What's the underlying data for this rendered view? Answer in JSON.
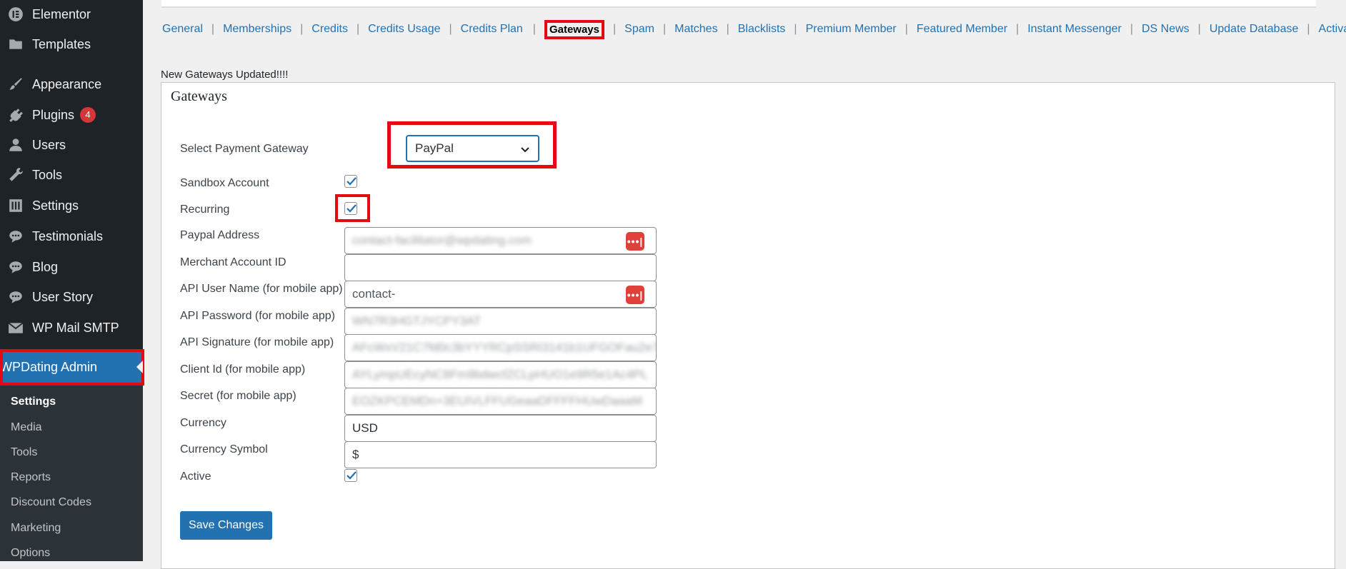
{
  "sidebar": {
    "items": [
      {
        "label": "Elementor",
        "icon": "elementor-icon"
      },
      {
        "label": "Templates",
        "icon": "folder-icon"
      },
      {
        "label": "Appearance",
        "icon": "paintbrush-icon"
      },
      {
        "label": "Plugins",
        "icon": "plug-icon",
        "badge": "4"
      },
      {
        "label": "Users",
        "icon": "user-icon"
      },
      {
        "label": "Tools",
        "icon": "wrench-icon"
      },
      {
        "label": "Settings",
        "icon": "settings-icon"
      },
      {
        "label": "Testimonials",
        "icon": "comment-icon"
      },
      {
        "label": "Blog",
        "icon": "comment-icon"
      },
      {
        "label": "User Story",
        "icon": "comment-icon"
      },
      {
        "label": "WP Mail SMTP",
        "icon": "mail-icon"
      }
    ],
    "active": {
      "label": "WPDating Admin",
      "icon": "gear-icon"
    },
    "submenu": [
      "Settings",
      "Media",
      "Tools",
      "Reports",
      "Discount Codes",
      "Marketing",
      "Options"
    ]
  },
  "tabs": [
    "General",
    "Memberships",
    "Credits",
    "Credits Usage",
    "Credits Plan",
    "Gateways",
    "Spam",
    "Matches",
    "Blacklists",
    "Premium Member",
    "Featured Member",
    "Instant Messenger",
    "DS News",
    "Update Database",
    "Activate License"
  ],
  "active_tab": "Gateways",
  "message": "New Gateways Updated!!!!",
  "panel": {
    "title": "Gateways",
    "select_label": "Select Payment Gateway",
    "selected_gateway": "PayPal",
    "sandbox_label": "Sandbox Account",
    "sandbox_checked": true,
    "recurring_label": "Recurring",
    "recurring_checked": true,
    "fields": [
      {
        "label": "Paypal Address",
        "value": "contact-facilitator@wpdating.com",
        "blurred": true,
        "pw_icon": true
      },
      {
        "label": "Merchant Account ID",
        "value": "",
        "blurred": false,
        "pw_icon": false
      },
      {
        "label": "API User Name (for mobile app)",
        "value": "contact-",
        "blurred": false,
        "pw_icon": true
      },
      {
        "label": "API Password (for mobile app)",
        "value": "WN7R3HGTJYCPY3AT",
        "blurred": true,
        "pw_icon": false
      },
      {
        "label": "API Signature (for mobile app)",
        "value": "AFcWxV21C7fd0c3bYYYRCpSSRI3141b1UFGOFau2e7B",
        "blurred": true,
        "pw_icon": false
      },
      {
        "label": "Client Id (for mobile app)",
        "value": "AYLympUEcyNC8Fm9bdwcfZCLpHUO1e9R5e1Ac4PL",
        "blurred": true,
        "pw_icon": false
      },
      {
        "label": "Secret (for mobile app)",
        "value": "EOZKPCEMDn+3EUIVLFFUGeaaDFFFFHUwDaaaM",
        "blurred": true,
        "pw_icon": false
      },
      {
        "label": "Currency",
        "value": "USD",
        "blurred": false,
        "pw_icon": false
      },
      {
        "label": "Currency Symbol",
        "value": "$",
        "blurred": false,
        "pw_icon": false
      }
    ],
    "active_label": "Active",
    "active_checked": true,
    "save_label": "Save Changes"
  },
  "colors": {
    "sidebar_bg": "#1d2327",
    "accent": "#2271b1",
    "highlight": "#e50914"
  }
}
